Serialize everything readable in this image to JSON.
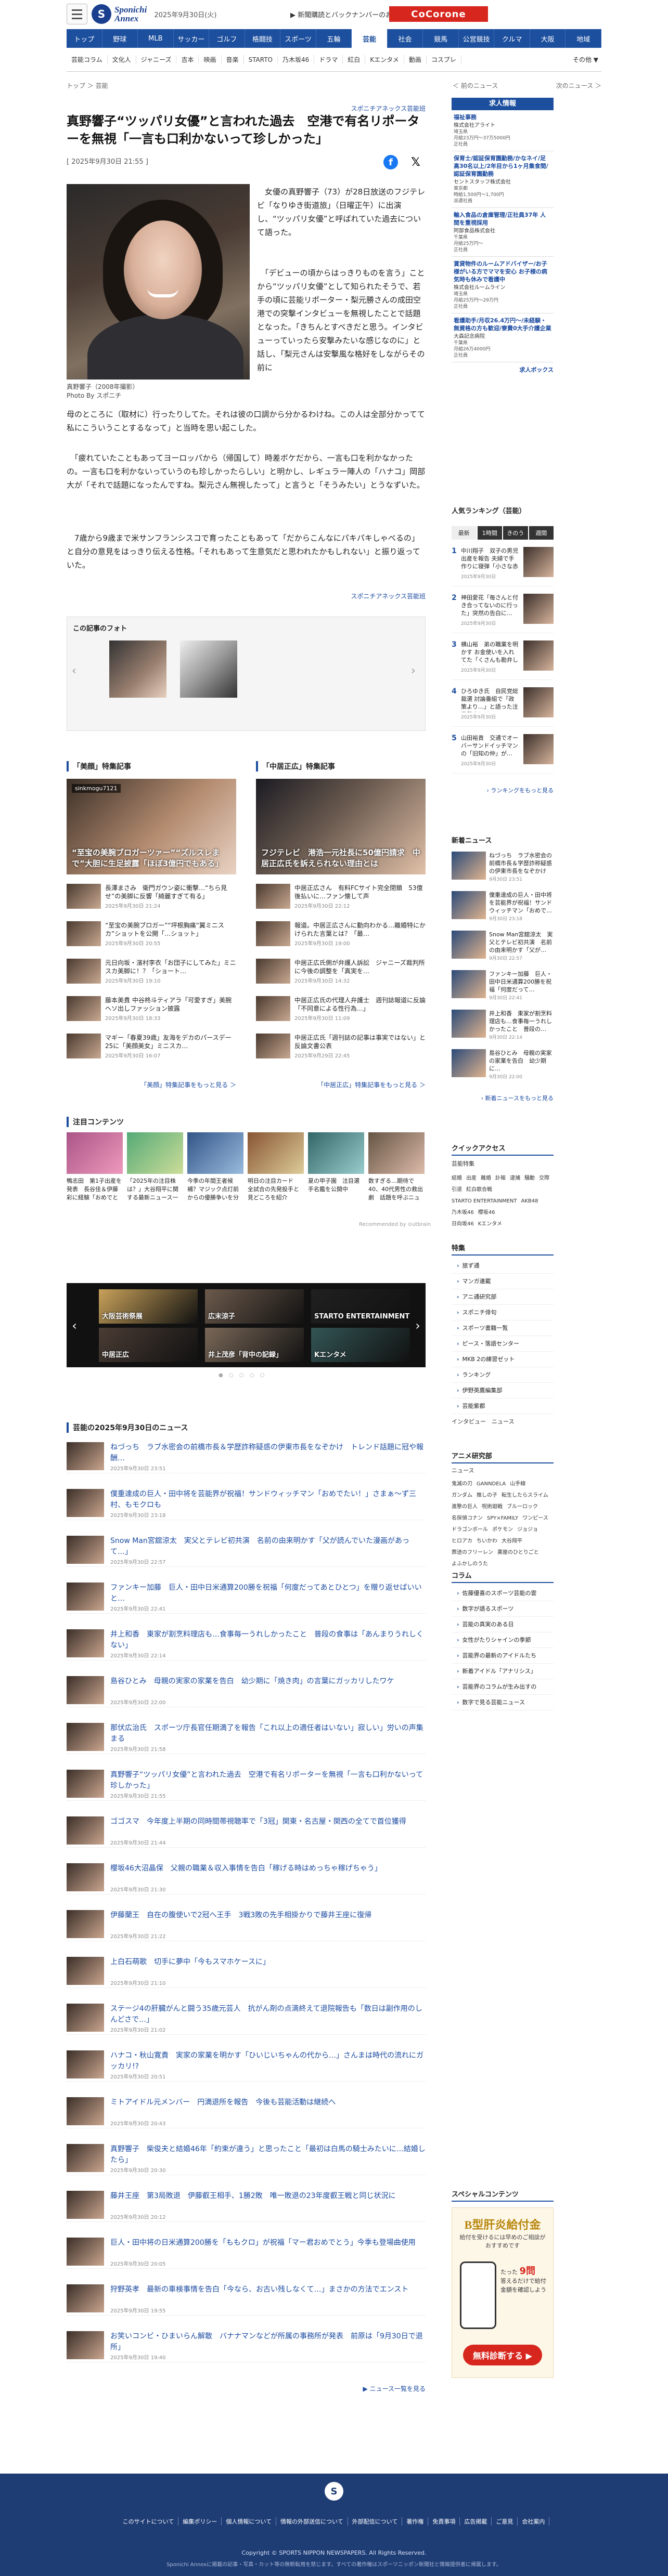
{
  "header": {
    "logo_mark": "S",
    "logo_line1": "Sponichi",
    "logo_line2": "Annex",
    "date": "2025年9月30日(火)",
    "notice": "▶ 新聞購読とバックナンバーのお申込み",
    "ad_label": "CoCorone"
  },
  "nav_primary": [
    "トップ",
    "野球",
    "MLB",
    "サッカー",
    "ゴルフ",
    "格闘技",
    "スポーツ",
    "五輪",
    "芸能",
    "社会",
    "競馬",
    "公営競技",
    "クルマ",
    "大阪",
    "地域"
  ],
  "nav_primary_active": "芸能",
  "nav_secondary": [
    "芸能コラム",
    "文化人",
    "ジャニーズ",
    "吉本",
    "映画",
    "音楽",
    "STARTO",
    "乃木坂46",
    "ドラマ",
    "紅白",
    "Kエンタメ",
    "動画",
    "コスプレ"
  ],
  "nav_secondary_more": "その他 ▼",
  "breadcrumb": "トップ ＞ 芸能",
  "prev_link": "＜ 前のニュース",
  "next_link": "次のニュース ＞",
  "article": {
    "source": "スポニチアネックス芸能班",
    "headline": "真野響子“ツッパリ女優”と言われた過去　空港で有名リポーターを無視「一言も口利かないって珍しかった」",
    "published": "[ 2025年9月30日 21:55 ]",
    "photo_caption": "真野響子（2008年撮影）",
    "photo_credit": "Photo By スポニチ",
    "p1": "　女優の真野響子（73）が28日放送のフジテレビ「なりゆき街道旅」（日曜正午）に出演し、“ツッパリ女優”と呼ばれていた過去について語った。",
    "p2": "　「デビューの頃からはっきりものを言う」ことから“ツッパリ女優”として知られたそうで、若手の頃に芸能リポーター・梨元勝さんの成田空港での突撃インタビューを無視したことで話題となった。「きちんとすべきだと思う。インタビューっていったら安撃みたいな感じなのに」と話し、「梨元さんは安撃風な格好をしながらその前に",
    "p2b": "母のところに（取材に）行ったりしてた。それは彼の口調から分かるわけね。この人は全部分かってて私にこういうことするなって」と当時を思い起こした。",
    "p3": "　「疲れていたこともあってヨーロッパから（帰国して）時差ボケだから、一言も口を利かなかったの。一言も口を利かないっていうのも珍しかったらしい」と明かし、レギュラー陣人の「ハナコ」岡部大が「それで話題になったんですね。梨元さん無視したって」と言うと「そうみたい」とうなずいた。",
    "p4": "　7歳から9歳まで米サンフランシスコで育ったこともあって「だからこんなにパキパキしゃべるの」と自分の意見をはっきり伝える性格。「それもあって生意気だと思われたかもしれない」と振り返っていた。",
    "source_bottom": "スポニチアネックス芸能班"
  },
  "related": {
    "title": "この記事のフォト"
  },
  "features": [
    {
      "title": "「美顔」特集記事",
      "hero_badge": "sinkmogu7121",
      "hero_caption": "“至宝の美腕ブロガーツァー”“ズルスレまで”大胆に生足披露「ほぼ3億円でもある」",
      "items": [
        {
          "text": "長澤まさみ　衛門ガウン姿に衝撃…“ちら見せ”の美脚に反響「綺麗すぎて有る」",
          "date": "2025年9月30日 21:24"
        },
        {
          "text": "“至宝の美腕ブロガー”“坪根胸痛“翼ミニスカ”ショットを公開「…ショット」",
          "date": "2025年9月30日 20:55"
        },
        {
          "text": "元日向坂・濱村李衣「お団子にしてみた」ミニスカ美脚に！？「ショート…",
          "date": "2025年9月30日 19:10"
        },
        {
          "text": "藤本美貴 中谷柊斗ティアラ「可愛すぎ」美腕ヘソ出しファッション披露",
          "date": "2025年9月30日 18:33"
        },
        {
          "text": "マギー「春夏39歳」友海をデカのパースデー25に「美顔美女」ミニスカ…",
          "date": "2025年9月30日 16:07"
        }
      ],
      "more": "「美顔」特集記事をもっと見る ＞"
    },
    {
      "title": "「中居正広」特集記事",
      "hero_badge": "",
      "hero_caption": "フジテレビ　港浩一元社長に50億円請求　中居正広氏を訴えられない理由とは",
      "items": [
        {
          "text": "中居正広さん　有料FCサイト完全閉鎖　53億後払いに…ファン懐して声",
          "date": "2025年9月30日 22:12"
        },
        {
          "text": "報道。中居正広さんに動向わかる…離婚特にかけられた言葉とは？「最…",
          "date": "2025年9月30日 19:00"
        },
        {
          "text": "中居正広氏側が弁護人訴訟　ジャニーズ裁判所に今後の調整を「真実を…",
          "date": "2025年9月30日 14:32"
        },
        {
          "text": "中居正広氏の代理人弁護士　週刊誌報道に反論「不同意による性行為…」",
          "date": "2025年9月30日 11:09"
        },
        {
          "text": "中居正広氏「週刊誌の記事は事実ではない」と反論文書公表",
          "date": "2025年9月29日 22:45"
        }
      ],
      "more": "「中居正広」特集記事をもっと見る ＞"
    }
  ],
  "attention": {
    "title": "注目コンテンツ",
    "items": [
      {
        "text": "鴨志田　第1子出産を発表　長谷佳＆伊藤彩に経験「おめでとう」"
      },
      {
        "text": "「2025年の注目株は？」大谷翔平に関する最新ニュース一覧"
      },
      {
        "text": "今季の年間王者候補？マジック点灯前からの優勝争いを分析"
      },
      {
        "text": "明日の注目カード　全試合の先発投手と見どころを紹介"
      },
      {
        "text": "夏の甲子園　注目選手名鑑を公開中"
      },
      {
        "text": "数すぎる…期待で40、40代男性の救出劇　話題を呼ぶニュース"
      }
    ],
    "credit": "Recommended by ⊙utbrain"
  },
  "carousel": {
    "tiles": [
      "大阪芸術祭展",
      "広末涼子",
      "STARTO ENTERTAINMENT",
      "中居正広",
      "井上茂彦「背中の記録」",
      "Kエンタメ"
    ],
    "dots": "● ○ ○ ○ ○"
  },
  "news_list": {
    "title": "芸能の2025年9月30日のニュース",
    "items": [
      {
        "text": "ねづっち　ラブ水密会の前橋市長＆学歴詐称疑惑の伊東市長をなぞかけ　トレンド話題に冠や報酬…",
        "date": "2025年9月30日 23:51"
      },
      {
        "text": "僕重達成の巨人・田中将を芸能界が祝福！サンドウィッチマン「おめでたい！」さまぁ～ず三村、もモクロも",
        "date": "2025年9月30日 23:18"
      },
      {
        "text": "Snow Man宮舘涼太　実父とテレビ初共演　名前の由来明かす「父が読んでいた漫画があって…」",
        "date": "2025年9月30日 22:57"
      },
      {
        "text": "ファンキー加藤　巨人・田中日米通算200勝を祝福「何度だってあとひとつ」を贈り返せばいいと…",
        "date": "2025年9月30日 22:41"
      },
      {
        "text": "井上和香　東家が割烹料理店も…食事毎一うれしかったこと　普段の食事は「あんまりうれしくない」",
        "date": "2025年9月30日 22:14"
      },
      {
        "text": "島谷ひとみ　母親の実家の家業を告白　幼少期に「焼き肉」の言葉にガッカリしたワケ",
        "date": "2025年9月30日 22:00"
      },
      {
        "text": "那伏広治氏　スポーツ庁長官任期満了を報告「これ以上の適任者はいない」寂しい」労いの声集まる",
        "date": "2025年9月30日 21:58"
      },
      {
        "text": "真野響子“ツッパリ女優”と言われた過去　空港で有名リポーターを無視「一言も口利かないって珍しかった」",
        "date": "2025年9月30日 21:55"
      },
      {
        "text": "ゴゴスマ　今年度上半期の同時間帯視聴率で「3冠」関東・名古屋・関西の全てで首位獲得",
        "date": "2025年9月30日 21:44"
      },
      {
        "text": "櫻坂46大沼晶保　父親の職業＆収入事情を告白「稼げる時はめっちゃ稼げちゃう」",
        "date": "2025年9月30日 21:30"
      },
      {
        "text": "伊藤蘭王　自在の腹使いで2冠へ王手　3戦3敗の先手相掛かりで藤井王座に復帰",
        "date": "2025年9月30日 21:22"
      },
      {
        "text": "上白石萌歌　切手に夢中「今もスマホケースに」",
        "date": "2025年9月30日 21:10"
      },
      {
        "text": "ステージ4の肝臓がんと闘う35歳元芸人　抗がん剤の点滴終えて退院報告も「数日は副作用のしんどさで…」",
        "date": "2025年9月30日 21:02"
      },
      {
        "text": "ハナコ・秋山寛貴　実家の家業を明かす「ひいじいちゃんの代から…」さんまは時代の流れにガッカリ!?",
        "date": "2025年9月30日 20:51"
      },
      {
        "text": "ミトアイドル元メンバー　円満退所を報告　今後も芸能活動は継続へ",
        "date": "2025年9月30日 20:43"
      },
      {
        "text": "真野響子　柴俊夫と結婚46年「約束が違う」と思ったこと「最初は白馬の騎士みたいに…結婚したら」",
        "date": "2025年9月30日 20:30"
      },
      {
        "text": "藤井王座　第3局敗退　伊藤叡王相手、1勝2敗　唯一敗退の23年度叡王戦と同じ状況に",
        "date": "2025年9月30日 20:12"
      },
      {
        "text": "巨人・田中将の日米通算200勝を「ももクロ」が祝福「マー君おめでとう」今季も登場曲使用",
        "date": "2025年9月30日 20:05"
      },
      {
        "text": "狩野英孝　最新の車検事情を告白「今なら、お古い残しなくて…」まさかの方法でエンスト",
        "date": "2025年9月30日 19:55"
      },
      {
        "text": "お笑いコンビ・ひまいらん解散　バナナマンなどが所属の事務所が発表　前原は「9月30日で退所」",
        "date": "2025年9月30日 19:40"
      }
    ],
    "more": "▶ ニュース一覧を見る"
  },
  "sidebar": {
    "jobs": {
      "title": "求人情報",
      "items": [
        {
          "title": "福祉事務",
          "company": "株式会社アライト",
          "meta1": "埼玉県",
          "meta2": "月給23万円〜37万5000円",
          "meta3": "正社員"
        },
        {
          "title": "保育士/認証保育園勤務/かなネイ/足高30名以上/2年目から1ヶ月集食間/認証保育園勤務",
          "company": "セントスタッフ株式会社",
          "meta1": "東京都",
          "meta2": "時給1,500円〜1,700円",
          "meta3": "派遣社員"
        },
        {
          "title": "輸入食品の倉庫管理/正社員37年 人間を重視採用",
          "company": "阿部食品株式会社",
          "meta1": "千葉県",
          "meta2": "月給25万円〜",
          "meta3": "正社員"
        },
        {
          "title": "賃貸物件のルームアドバイザー/お子様がいる方でママを安心 お子様の病気時も休みで看護中",
          "company": "株式会社ルームライン",
          "meta1": "埼玉県",
          "meta2": "月給25万円〜29万円",
          "meta3": "正社員"
        },
        {
          "title": "看護助手/月収26.4万円〜/未経験・無資格の方も歓迎/寮費0大手介護企業",
          "company": "大森記念病院",
          "meta1": "千葉県",
          "meta2": "月給26万4000円",
          "meta3": "正社員"
        }
      ],
      "footer": "求人ボックス"
    },
    "ranking": {
      "title": "人気ランキング（芸能）",
      "tabs": [
        "最新",
        "1時間",
        "きのう",
        "週間"
      ],
      "active_tab": "最新",
      "items": [
        {
          "text": "中川翔子　双子の男児出産を報告 夫婦で手作りに寝弾「小さな赤ちゃん…」",
          "date": "2025年9月30日"
        },
        {
          "text": "神田愛花「毎さんと付き合ってないのに行った」突然の告白に…",
          "date": "2025年9月30日"
        },
        {
          "text": "横山裕　弟の職業を明かす お金使いを入れてた「くさんも勘弁したよ」",
          "date": "2025年9月30日"
        },
        {
          "text": "ひろゆき氏　自民党総裁選 討論番組で「政策より…」と語った注目発言とは",
          "date": "2025年9月30日"
        },
        {
          "text": "山田裕貴　交通でオーバーサンドイッチマンの「旧知の仲」が…",
          "date": "2025年9月30日"
        }
      ],
      "more": "› ランキングをもっと見る"
    },
    "new_news": {
      "title": "新着ニュース",
      "items": [
        {
          "text": "ねづっち　ラブ水密会の前橋市長＆学歴詐称疑惑の伊東市長をなぞかけ　トレ…",
          "date": "9月30日 23:51"
        },
        {
          "text": "僕重達成の巨人・田中将を芸能界が祝福！サンドウィッチマン「おめで…",
          "date": "9月30日 23:18"
        },
        {
          "text": "Snow Man宮舘涼太　実父とテレビ初共演　名前の由来明かす「父が…",
          "date": "9月30日 22:57"
        },
        {
          "text": "ファンキー加藤　巨人・田中日米通算200勝を祝福「何度だって…",
          "date": "9月30日 22:41"
        },
        {
          "text": "井上和香　東家が割烹料理店も…食事毎一うれしかったこと　普段の…",
          "date": "9月30日 22:14"
        },
        {
          "text": "島谷ひとみ　母親の実家の家業を告白　幼少期に…",
          "date": "9月30日 22:00"
        }
      ],
      "more": "› 新着ニュースをもっと見る"
    },
    "quick_access": {
      "title": "クイックアクセス",
      "sub": "芸能特集",
      "tags": [
        "結婚",
        "出産",
        "離婚",
        "訃報",
        "逮捕",
        "騒動",
        "交際",
        "引退",
        "紅白歌合戦",
        "STARTO ENTERTAINMENT",
        "AKB48",
        "乃木坂46",
        "櫻坂46",
        "日向坂46",
        "Kエンタメ"
      ]
    },
    "special": {
      "title": "特集",
      "items": [
        "旅ず通",
        "マンガ連載",
        "アニ通研究部",
        "スポニチ俳句",
        "スポーツ書籍一覧",
        "ピース・落語センター",
        "MKB 2の練習ゼット",
        "ランキング",
        "伊野英鷹編集部",
        "芸能紫都"
      ],
      "sub": "インタビュー　ニュース"
    },
    "anime": {
      "title": "アニメ研究部",
      "sub": "ニュース",
      "tags": [
        "鬼滅の刃",
        "GANNDELA",
        "山手線",
        "ガンダム",
        "推しの子",
        "転生したらスライム",
        "進撃の巨人",
        "呪術廻戦",
        "ブルーロック",
        "名探偵コナン",
        "SPY×FAMILY",
        "ワンピース",
        "ドラゴンボール",
        "ポケモン",
        "ジョジョ",
        "ヒロアカ",
        "ちいかわ",
        "大谷翔平",
        "葬送のフリーレン",
        "薬屋のひとりごと",
        "よふかしのうた"
      ]
    },
    "column": {
      "title": "コラム",
      "items": [
        "佐藤優喜のスポーツ芸能の雲",
        "数字が語るスポーツ",
        "芸能の真実のある日",
        "女性がたりシャインの季節",
        "芸能界の最新のアイドルたち",
        "新着アイドル「アナリシス」",
        "芸能界のコラムが生み出すの",
        "数字で見る芸能ニュース"
      ]
    },
    "special_content": {
      "title": "スペシャルコンテンツ"
    },
    "promo": {
      "head": "B型肝炎給付金",
      "sub": "給付を受けるには早めのご相談がおすすめです",
      "line1": "たった",
      "line2": "9問",
      "line3": "答えるだけで給付金額を確認しよう",
      "button": "無料診断する ▶"
    }
  },
  "footer": {
    "logo": "S",
    "links": [
      "このサイトについて",
      "編集ポリシー",
      "個人情報について",
      "情報の外部送信について",
      "外部配信について",
      "著作権",
      "免責事項",
      "広告掲載",
      "ご意見",
      "会社案内"
    ],
    "copyright": "Copyright © SPORTS NIPPON NEWSPAPERS. All Rights Reserved.",
    "notice": "Sponichi Annexに掲載の記事・写真・カット等の無断転用を禁じます。すべての著作権はスポーツニッポン新聞社と情報提供者に帰属します。"
  }
}
